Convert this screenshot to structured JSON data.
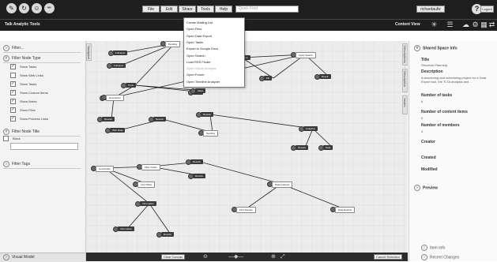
{
  "topbar": {
    "icons": [
      "pin-icon",
      "refresh-icon",
      "people-icon",
      "jar-icon"
    ],
    "menu": [
      "File",
      "Edit",
      "Share",
      "Tools",
      "Help"
    ],
    "quick_placeholder": "Quick Find",
    "username": "richardaultz",
    "logout_label": "Logout"
  },
  "subbar": {
    "title": "Talk Analytic Tools",
    "content_view": "Content View"
  },
  "dropdown": {
    "items": [
      {
        "label": "Create Mailing List",
        "enabled": true
      },
      {
        "label": "Open Files",
        "enabled": true
      },
      {
        "label": "Open Data Export",
        "enabled": true
      },
      {
        "label": "Open Tasks",
        "enabled": true
      },
      {
        "label": "Export to Google Docs",
        "enabled": true
      },
      {
        "label": "Open Search",
        "enabled": true
      },
      {
        "label": "Load RSS Finder",
        "enabled": true
      },
      {
        "label": "Open Visual Analysis",
        "enabled": false
      },
      {
        "label": "Open Forum",
        "enabled": true
      },
      {
        "label": "Open Timeline Analyzer",
        "enabled": true
      }
    ]
  },
  "left_panel": {
    "filter_label": "Filter...",
    "node_type_head": "Filter Node Type",
    "node_types": [
      {
        "label": "Show Tasks",
        "checked": true
      },
      {
        "label": "Show Web Links",
        "checked": false
      },
      {
        "label": "Show Tasks",
        "checked": true
      },
      {
        "label": "Show Custom Items",
        "checked": true
      },
      {
        "label": "Show Notes",
        "checked": true
      },
      {
        "label": "Show Files",
        "checked": true
      },
      {
        "label": "Show Process Links",
        "checked": true
      }
    ],
    "node_title_head": "Filter Node Title",
    "node_title_opt": "Black",
    "tags_head": "Filter Tags",
    "bottom_label": "Visual Model"
  },
  "canvas": {
    "side_tabs": [
      "Navigator",
      "Descriptions",
      "Description",
      "Nodes"
    ],
    "nodes": [
      {
        "label": "Fullname",
        "dark": true
      },
      {
        "label": "Fullname",
        "dark": true
      },
      {
        "label": "Pending",
        "dark": false
      },
      {
        "label": "Data Source",
        "dark": true
      },
      {
        "label": "Apply Search",
        "dark": false
      },
      {
        "label": "Tools",
        "dark": true
      },
      {
        "label": "Tools",
        "dark": true
      },
      {
        "label": "Scheduled",
        "dark": true
      },
      {
        "label": "Results",
        "dark": true
      },
      {
        "label": "Ideas",
        "dark": true
      },
      {
        "label": "Web Data",
        "dark": true
      },
      {
        "label": "Results",
        "dark": true
      },
      {
        "label": "Description",
        "dark": false
      },
      {
        "label": "Pending",
        "dark": false
      },
      {
        "label": "Results",
        "dark": true
      },
      {
        "label": "Result",
        "dark": true
      },
      {
        "label": "Fill",
        "dark": true
      },
      {
        "label": "Analytics",
        "dark": true
      },
      {
        "label": "Results",
        "dark": true
      },
      {
        "label": "Data",
        "dark": true
      },
      {
        "label": "Coordinate",
        "dark": false
      },
      {
        "label": "Filter Fields",
        "dark": false
      },
      {
        "label": "Link Offset",
        "dark": false
      },
      {
        "label": "Results",
        "dark": true
      },
      {
        "label": "Results",
        "dark": true
      },
      {
        "label": "Information",
        "dark": true
      },
      {
        "label": "Information",
        "dark": true
      },
      {
        "label": "Results",
        "dark": true
      },
      {
        "label": "Data Analysis",
        "dark": false
      },
      {
        "label": "Fine Results",
        "dark": false
      },
      {
        "label": "Data Results",
        "dark": false
      }
    ],
    "bottom_left_btn": "Clear Canvas",
    "bottom_right_btn": "Cancel Selection"
  },
  "right_panel": {
    "head": "Shared Space Info",
    "title_label": "Title",
    "title_value": "Structure Planning",
    "desc_label": "Description",
    "desc_value": "A structuring and scheduling project for a Data Export tool, the TLTA analysis and ...",
    "tasks_label": "Number of tasks",
    "tasks_value": "6",
    "members_label": "Number of members",
    "members_value": "4",
    "content_items_label": "Number of content items",
    "content_items_value": "0",
    "creator_label": "Creator",
    "created_label": "Created",
    "modified_label": "Modified",
    "preview_label": "Preview",
    "foot1": "Item Info",
    "foot2": "Recent Changes"
  },
  "colors": {
    "bar": "#1e1e1e",
    "canvas": "#ececec",
    "node": "#3a3a3a"
  }
}
